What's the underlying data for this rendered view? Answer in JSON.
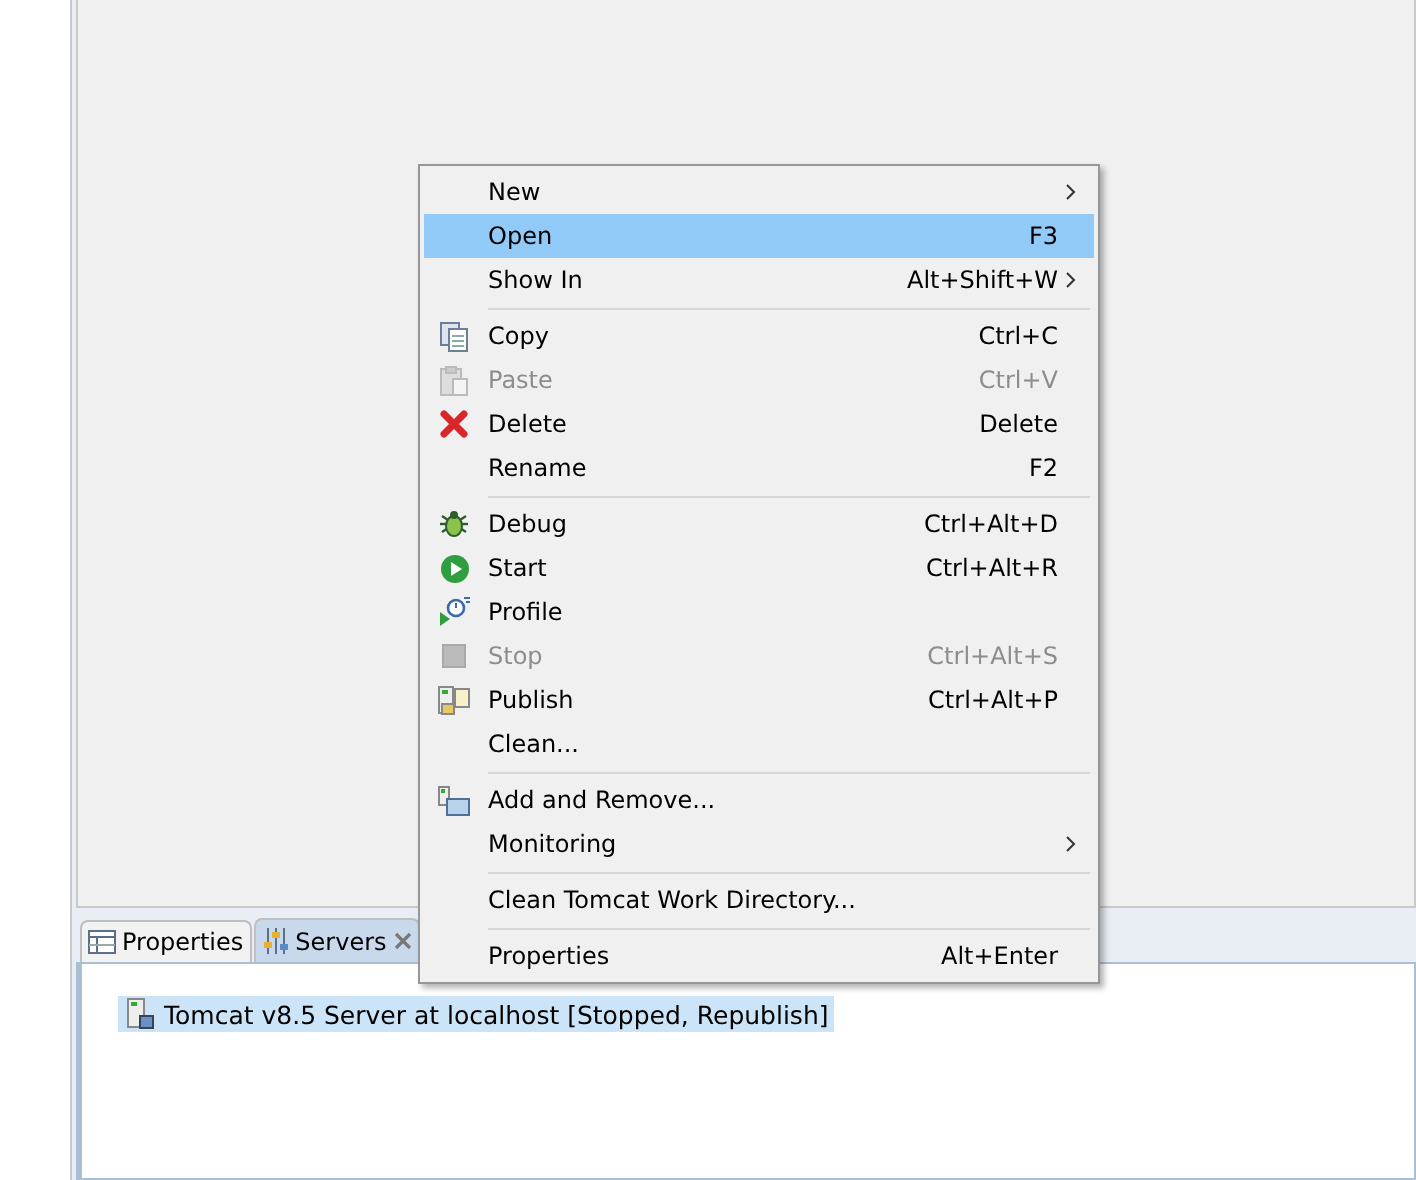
{
  "views": {
    "tabs": [
      {
        "label": "Properties",
        "selected": false,
        "closable": false
      },
      {
        "label": "Servers",
        "selected": true,
        "closable": true
      }
    ],
    "servers": [
      {
        "label": "Tomcat v8.5 Server at localhost  [Stopped, Republish]",
        "selected": true
      }
    ]
  },
  "context_menu": {
    "items": [
      {
        "kind": "item",
        "label": "New",
        "submenu": true,
        "disabled": false,
        "selected": false
      },
      {
        "kind": "item",
        "label": "Open",
        "shortcut": "F3",
        "submenu": false,
        "disabled": false,
        "selected": true
      },
      {
        "kind": "item",
        "label": "Show In",
        "shortcut": "Alt+Shift+W",
        "submenu": true,
        "disabled": false,
        "selected": false
      },
      {
        "kind": "separator"
      },
      {
        "kind": "item",
        "label": "Copy",
        "shortcut": "Ctrl+C",
        "submenu": false,
        "disabled": false,
        "selected": false
      },
      {
        "kind": "item",
        "label": "Paste",
        "shortcut": "Ctrl+V",
        "submenu": false,
        "disabled": true,
        "selected": false
      },
      {
        "kind": "item",
        "label": "Delete",
        "shortcut": "Delete",
        "submenu": false,
        "disabled": false,
        "selected": false
      },
      {
        "kind": "item",
        "label": "Rename",
        "shortcut": "F2",
        "submenu": false,
        "disabled": false,
        "selected": false
      },
      {
        "kind": "separator"
      },
      {
        "kind": "item",
        "label": "Debug",
        "shortcut": "Ctrl+Alt+D",
        "submenu": false,
        "disabled": false,
        "selected": false
      },
      {
        "kind": "item",
        "label": "Start",
        "shortcut": "Ctrl+Alt+R",
        "submenu": false,
        "disabled": false,
        "selected": false
      },
      {
        "kind": "item",
        "label": "Profile",
        "submenu": false,
        "disabled": false,
        "selected": false
      },
      {
        "kind": "item",
        "label": "Stop",
        "shortcut": "Ctrl+Alt+S",
        "submenu": false,
        "disabled": true,
        "selected": false
      },
      {
        "kind": "item",
        "label": "Publish",
        "shortcut": "Ctrl+Alt+P",
        "submenu": false,
        "disabled": false,
        "selected": false
      },
      {
        "kind": "item",
        "label": "Clean...",
        "submenu": false,
        "disabled": false,
        "selected": false
      },
      {
        "kind": "separator"
      },
      {
        "kind": "item",
        "label": "Add and Remove...",
        "submenu": false,
        "disabled": false,
        "selected": false
      },
      {
        "kind": "item",
        "label": "Monitoring",
        "submenu": true,
        "disabled": false,
        "selected": false
      },
      {
        "kind": "separator"
      },
      {
        "kind": "item",
        "label": "Clean Tomcat Work Directory...",
        "submenu": false,
        "disabled": false,
        "selected": false
      },
      {
        "kind": "separator"
      },
      {
        "kind": "item",
        "label": "Properties",
        "shortcut": "Alt+Enter",
        "submenu": false,
        "disabled": false,
        "selected": false
      }
    ]
  }
}
